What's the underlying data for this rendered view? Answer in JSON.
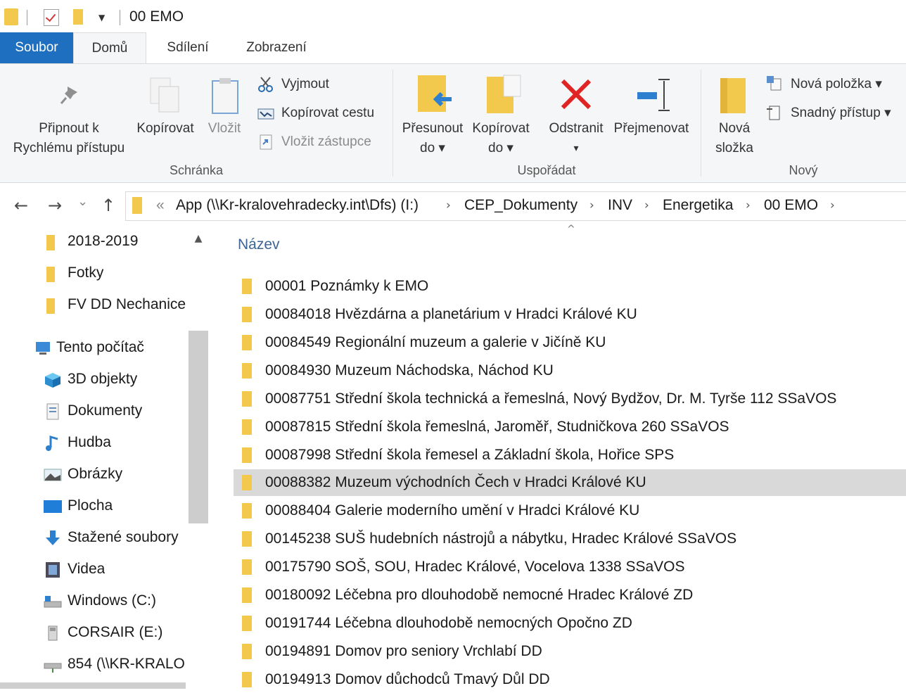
{
  "window": {
    "title": "00 EMO"
  },
  "ribbon": {
    "tabs": [
      {
        "label": "Soubor"
      },
      {
        "label": "Domů"
      },
      {
        "label": "Sdílení"
      },
      {
        "label": "Zobrazení"
      }
    ],
    "clipboard": {
      "pin_line1": "Připnout k",
      "pin_line2": "Rychlému přístupu",
      "copy": "Kopírovat",
      "paste": "Vložit",
      "cut": "Vyjmout",
      "copy_path": "Kopírovat cestu",
      "paste_shortcut": "Vložit zástupce",
      "group": "Schránka"
    },
    "organize": {
      "move_line1": "Přesunout",
      "move_line2": "do ▾",
      "copyto_line1": "Kopírovat",
      "copyto_line2": "do ▾",
      "delete": "Odstranit",
      "delete_arrow": "▾",
      "rename": "Přejmenovat",
      "group": "Uspořádat"
    },
    "new": {
      "new_folder_line1": "Nová",
      "new_folder_line2": "složka",
      "new_item": "Nová položka ▾",
      "easy_access": "Snadný přístup ▾",
      "group": "Nový"
    }
  },
  "address": {
    "back": "←",
    "forward": "→",
    "recent": "⌄",
    "up": "↑",
    "overflow": "«",
    "crumbs": [
      "App (\\\\Kr-kralovehradecky.int\\Dfs) (I:)",
      "CEP_Dokumenty",
      "INV",
      "Energetika",
      "00 EMO"
    ],
    "separator": "›"
  },
  "navpane": {
    "items": [
      {
        "label": "2018-2019",
        "icon": "folder-icon"
      },
      {
        "label": "Fotky",
        "icon": "folder-icon"
      },
      {
        "label": "FV DD Nechanice",
        "icon": "folder-icon"
      },
      {
        "label": "Tento počítač",
        "icon": "computer-icon"
      },
      {
        "label": "3D objekty",
        "icon": "3d-objects-icon"
      },
      {
        "label": "Dokumenty",
        "icon": "documents-icon"
      },
      {
        "label": "Hudba",
        "icon": "music-icon"
      },
      {
        "label": "Obrázky",
        "icon": "pictures-icon"
      },
      {
        "label": "Plocha",
        "icon": "desktop-icon"
      },
      {
        "label": "Stažené soubory",
        "icon": "downloads-icon"
      },
      {
        "label": "Videa",
        "icon": "videos-icon"
      },
      {
        "label": "Windows (C:)",
        "icon": "drive-icon"
      },
      {
        "label": "CORSAIR (E:)",
        "icon": "usb-drive-icon"
      },
      {
        "label": "854 (\\\\KR-KRALO",
        "icon": "network-drive-icon"
      }
    ],
    "scroll_up": "▲"
  },
  "files": {
    "sort_indicator": "^",
    "column_name": "Název",
    "rows": [
      {
        "name": "00001 Poznámky k EMO"
      },
      {
        "name": "00084018 Hvězdárna a planetárium v Hradci Králové KU"
      },
      {
        "name": "00084549 Regionální muzeum a galerie v Jičíně KU"
      },
      {
        "name": "00084930 Muzeum Náchodska, Náchod KU"
      },
      {
        "name": "00087751 Střední škola technická a řemeslná, Nový Bydžov, Dr. M. Tyrše 112 SSaVOS"
      },
      {
        "name": "00087815 Střední škola řemeslná, Jaroměř, Studničkova 260  SSaVOS"
      },
      {
        "name": "00087998 Střední škola řemesel a Základní škola, Hořice  SPS"
      },
      {
        "name": "00088382 Muzeum východních Čech v Hradci Králové KU",
        "selected": true
      },
      {
        "name": "00088404 Galerie moderního umění v Hradci Králové KU"
      },
      {
        "name": "00145238 SUŠ hudebních nástrojů a nábytku, Hradec Králové  SSaVOS"
      },
      {
        "name": "00175790 SOŠ, SOU, Hradec Králové, Vocelova 1338 SSaVOS"
      },
      {
        "name": "00180092 Léčebna pro dlouhodobě nemocné Hradec Králové ZD"
      },
      {
        "name": "00191744 Léčebna dlouhodobě nemocných Opočno ZD"
      },
      {
        "name": "00194891 Domov pro seniory Vrchlabí DD"
      },
      {
        "name": "00194913 Domov důchodců Tmavý Důl DD"
      }
    ]
  },
  "colors": {
    "accent": "#1f6fc0",
    "folder": "#f2c94c",
    "selection": "#d9d9d9",
    "header_text": "#3c6594"
  }
}
